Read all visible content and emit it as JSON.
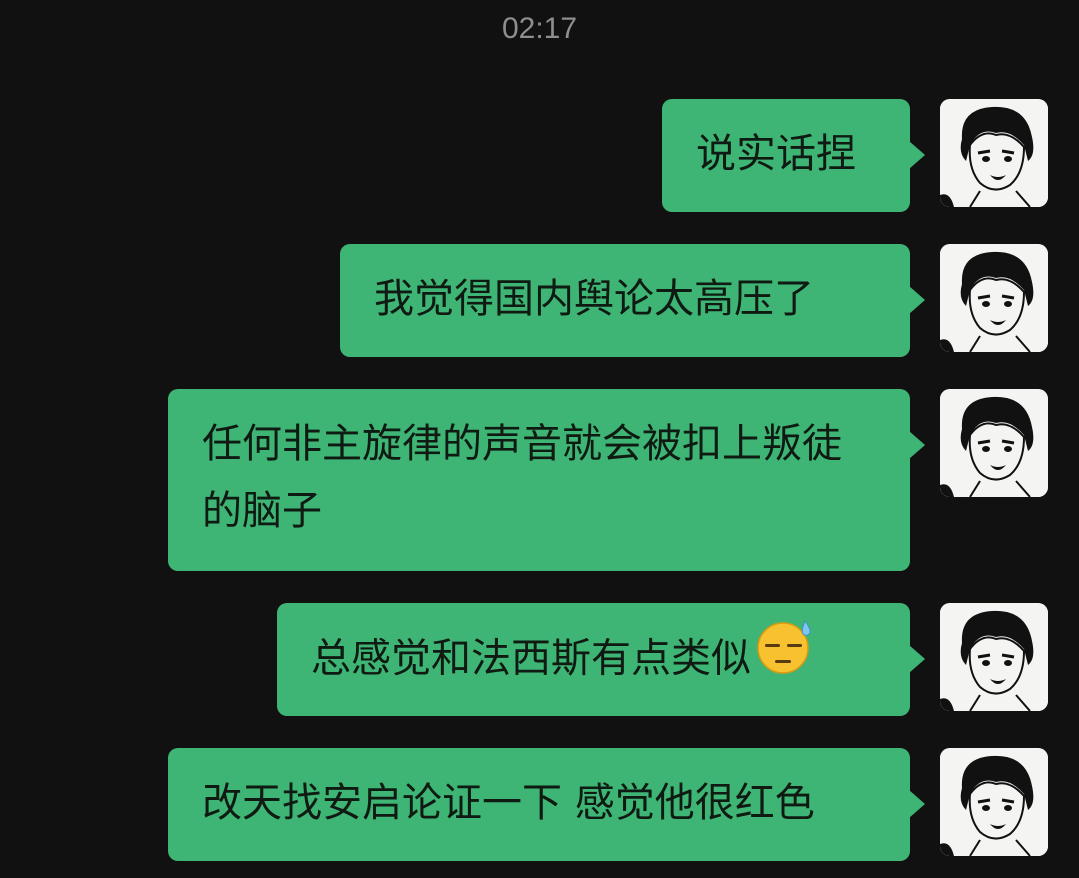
{
  "timestamp": "02:17",
  "colors": {
    "background": "#111111",
    "bubble": "#3eb575",
    "bubble_text": "#0f1a12",
    "timestamp_text": "#8e8e8e"
  },
  "messages": [
    {
      "text": "说实话捏",
      "sender": "self",
      "emoji": ""
    },
    {
      "text": "我觉得国内舆论太高压了",
      "sender": "self",
      "emoji": ""
    },
    {
      "text": "任何非主旋律的声音就会被扣上叛徒的脑子",
      "sender": "self",
      "emoji": ""
    },
    {
      "text": "总感觉和法西斯有点类似",
      "sender": "self",
      "emoji": "downcast-face-with-sweat-icon"
    },
    {
      "text": "改天找安启论证一下 感觉他很红色",
      "sender": "self",
      "emoji": ""
    }
  ],
  "avatar_icon": "manga-boy-avatar"
}
